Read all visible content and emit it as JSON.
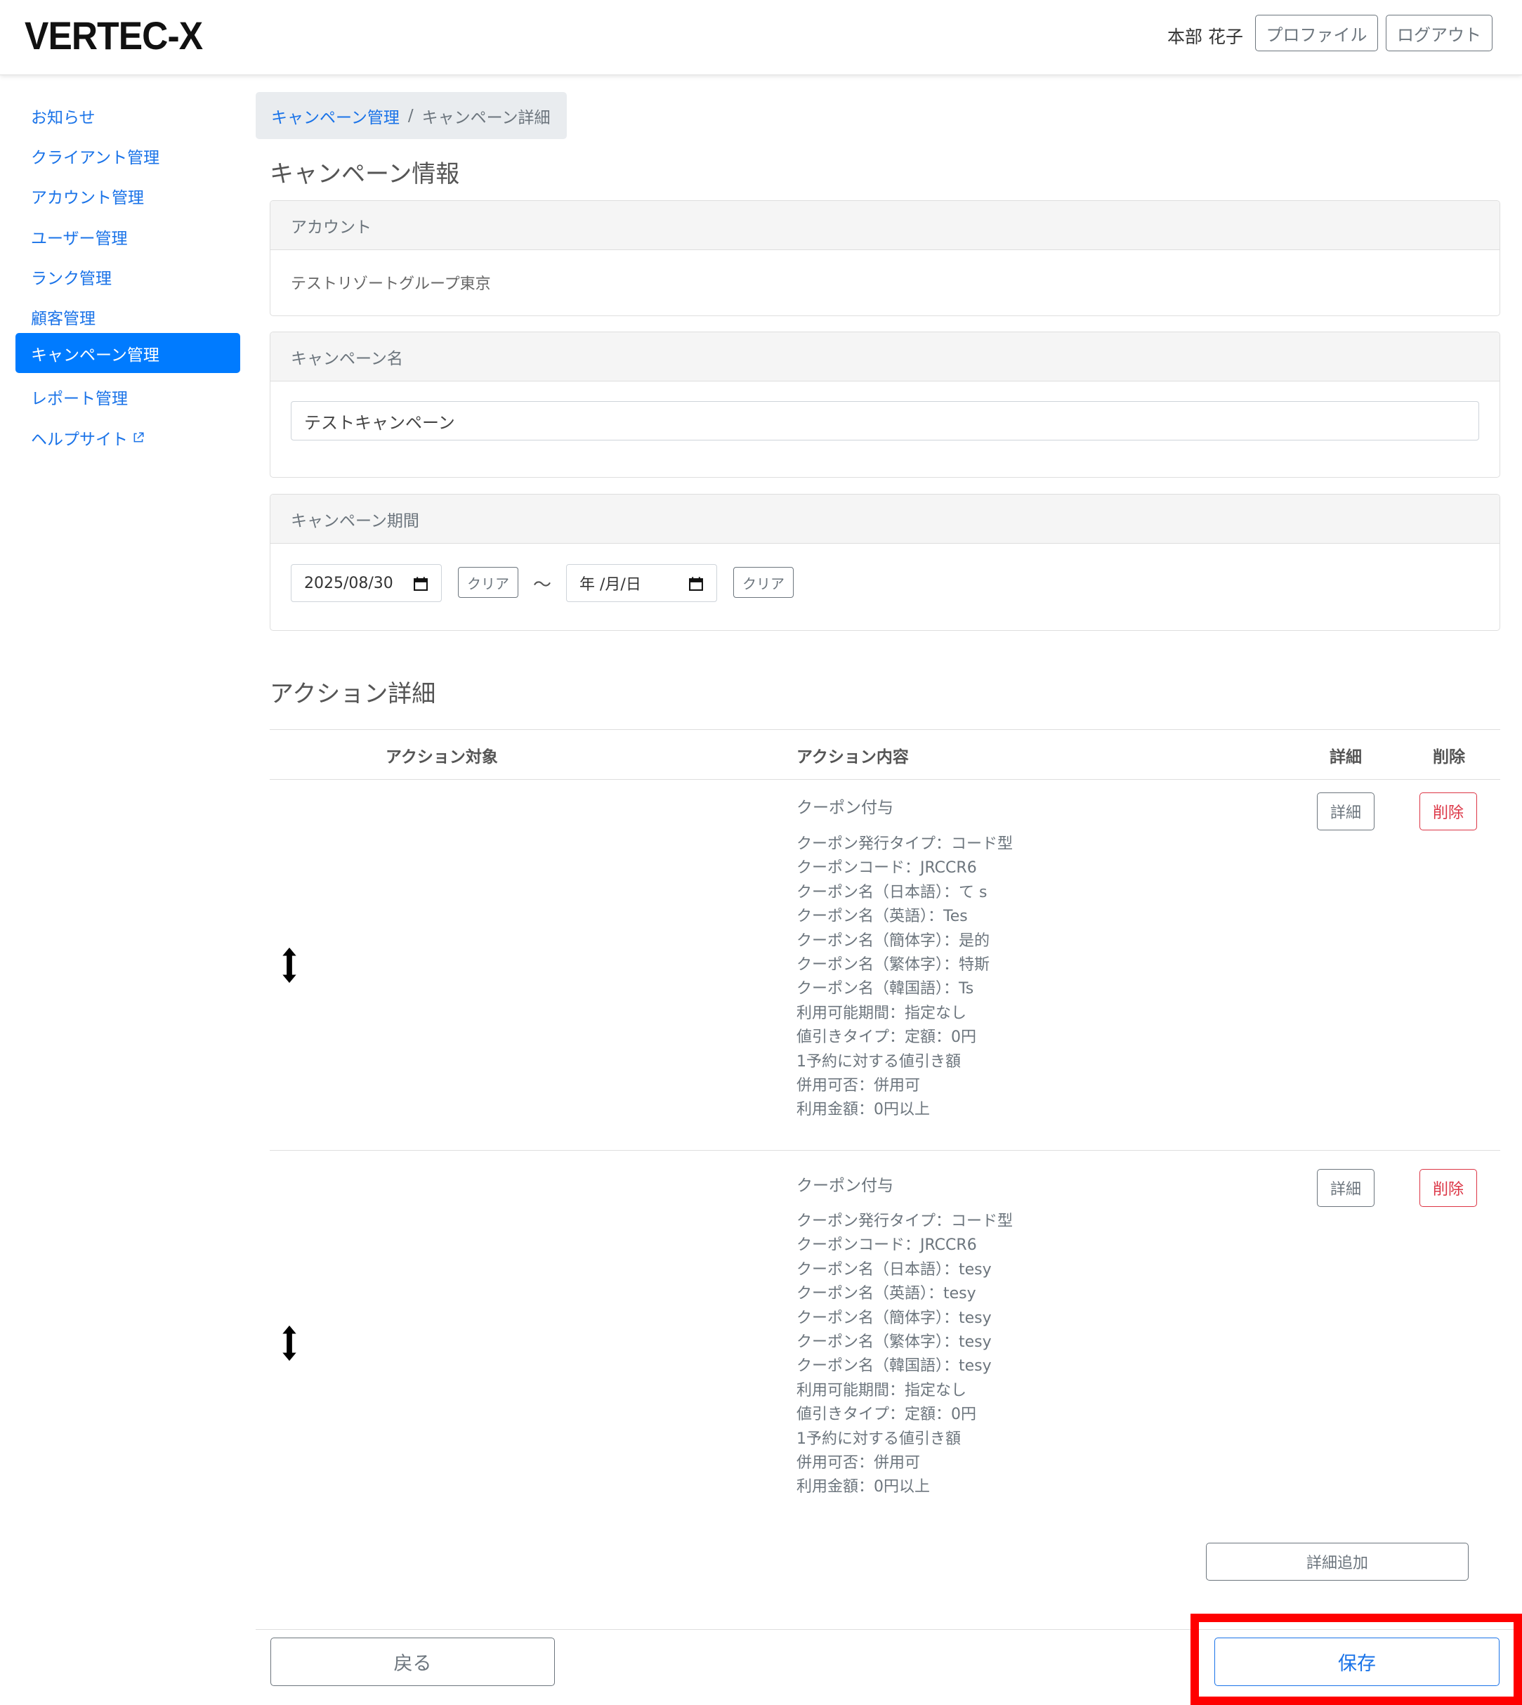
{
  "header": {
    "logo": "VERTEC-X",
    "user_name": "本部 花子",
    "profile_label": "プロファイル",
    "logout_label": "ログアウト"
  },
  "sidebar": {
    "items": [
      {
        "label": "お知らせ"
      },
      {
        "label": "クライアント管理"
      },
      {
        "label": "アカウント管理"
      },
      {
        "label": "ユーザー管理"
      },
      {
        "label": "ランク管理"
      },
      {
        "label": "顧客管理"
      },
      {
        "label": "キャンペーン管理",
        "active": true
      },
      {
        "label": "レポート管理"
      },
      {
        "label": "ヘルプサイト",
        "icon": "external-link-icon"
      }
    ]
  },
  "breadcrumb": {
    "parent": "キャンペーン管理",
    "separator": "/",
    "current": "キャンペーン詳細"
  },
  "campaign_info": {
    "title": "キャンペーン情報",
    "account": {
      "label": "アカウント",
      "value": "テストリゾートグループ東京"
    },
    "name": {
      "label": "キャンペーン名",
      "value": "テストキャンペーン"
    },
    "period": {
      "label": "キャンペーン期間",
      "start": "2025/08/30",
      "end_placeholder": "年 /月/日",
      "clear_label": "クリア",
      "tilde": "～"
    }
  },
  "actions": {
    "title": "アクション詳細",
    "columns": {
      "target": "アクション対象",
      "content": "アクション内容",
      "detail": "詳細",
      "delete": "削除"
    },
    "rows": [
      {
        "title": "クーポン付与",
        "lines": [
          "クーポン発行タイプ：コード型",
          "クーポンコード：JRCCR6",
          "クーポン名（日本語）：て s",
          "クーポン名（英語）：Tes",
          "クーポン名（簡体字）：是的",
          "クーポン名（繁体字）：特斯",
          "クーポン名（韓国語）：Ts",
          "利用可能期間：指定なし",
          "値引きタイプ：定額：0円",
          "1予約に対する値引き額",
          "併用可否：併用可",
          "利用金額：0円以上"
        ],
        "detail_label": "詳細",
        "delete_label": "削除"
      },
      {
        "title": "クーポン付与",
        "lines": [
          "クーポン発行タイプ：コード型",
          "クーポンコード：JRCCR6",
          "クーポン名（日本語）：tesy",
          "クーポン名（英語）：tesy",
          "クーポン名（簡体字）：tesy",
          "クーポン名（繁体字）：tesy",
          "クーポン名（韓国語）：tesy",
          "利用可能期間：指定なし",
          "値引きタイプ：定額：0円",
          "1予約に対する値引き額",
          "併用可否：併用可",
          "利用金額：0円以上"
        ],
        "detail_label": "詳細",
        "delete_label": "削除"
      }
    ],
    "add_detail_label": "詳細追加"
  },
  "footer": {
    "back_label": "戻る",
    "save_label": "保存"
  },
  "colors": {
    "primary": "#007bff",
    "link": "#1a73e8",
    "danger": "#dc3545",
    "highlight": "#ff0000"
  }
}
